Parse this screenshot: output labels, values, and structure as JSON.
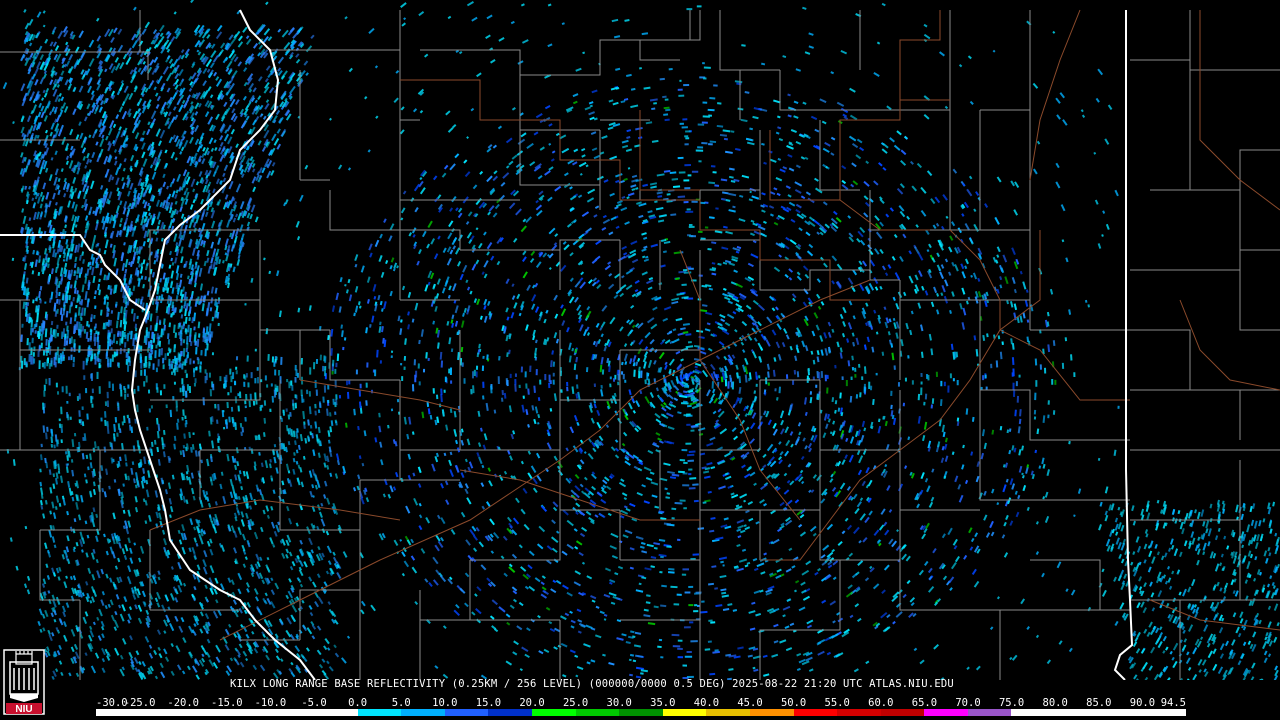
{
  "title_line": "KILX LONG RANGE BASE REFLECTIVITY (0.25KM / 256 LEVEL) (000000/0000 0.5 DEG) 2025-08-22 21:20 UTC  ATLAS.NIU.EDU",
  "logo_text": "NIU",
  "colors": {
    "background": "#000000",
    "county_lines": "#8a8a8a",
    "state_lines": "#ffffff",
    "roads": "#8b4a2b",
    "text": "#ffffff",
    "logo_red": "#c8102e"
  },
  "scale": {
    "labels": [
      "-30.0",
      "-25.0",
      "-20.0",
      "-15.0",
      "-10.0",
      "-5.0",
      "0.0",
      "5.0",
      "10.0",
      "15.0",
      "20.0",
      "25.0",
      "30.0",
      "35.0",
      "40.0",
      "45.0",
      "50.0",
      "55.0",
      "60.0",
      "65.0",
      "70.0",
      "75.0",
      "80.0",
      "85.0",
      "90.0",
      "94.5"
    ],
    "colors": [
      "#ffffff",
      "#ffffff",
      "#ffffff",
      "#ffffff",
      "#ffffff",
      "#ffffff",
      "#00e5ff",
      "#00b0ff",
      "#2060ff",
      "#0030c8",
      "#00ff00",
      "#00c800",
      "#009000",
      "#ffff00",
      "#e7c000",
      "#ff9000",
      "#ff0000",
      "#d40000",
      "#c00000",
      "#ff00ff",
      "#9955c9",
      "#ffffff",
      "#ffffff",
      "#ffffff",
      "#ffffff"
    ]
  }
}
